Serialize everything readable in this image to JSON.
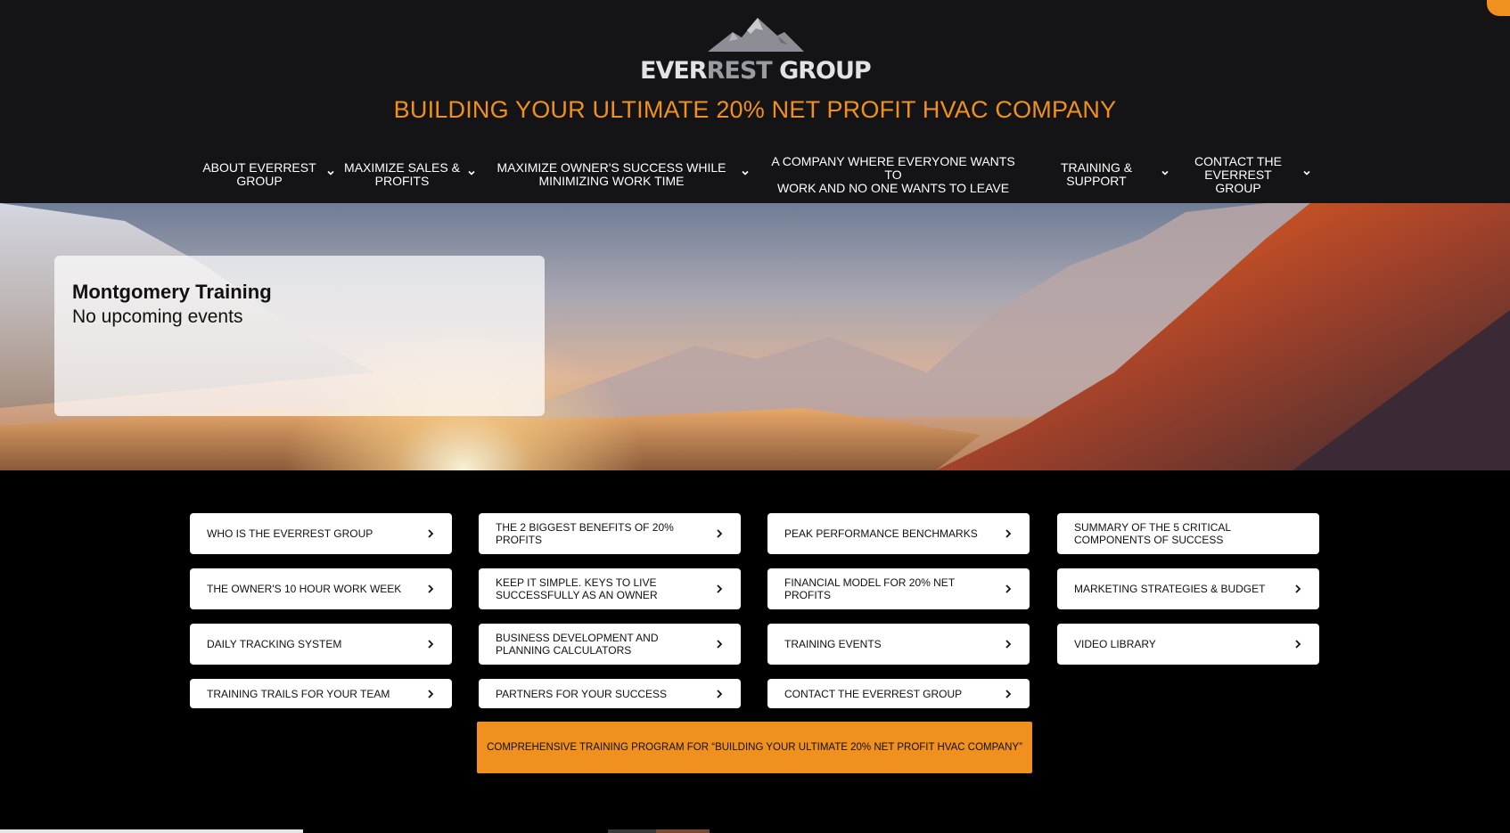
{
  "brand": {
    "logo_prefix": "EVER",
    "logo_accent": "REST",
    "logo_suffix": " GROUP",
    "logo_icon": "mountain-icon",
    "accent_color": "#f0901e",
    "header_bg": "#141416"
  },
  "tagline": "BUILDING YOUR ULTIMATE 20% NET PROFIT HVAC COMPANY",
  "nav": {
    "items": [
      {
        "label": "ABOUT EVERREST\nGROUP",
        "has_dropdown": true
      },
      {
        "label": "MAXIMIZE SALES &\nPROFITS",
        "has_dropdown": true
      },
      {
        "label": "MAXIMIZE OWNER'S SUCCESS WHILE\nMINIMIZING WORK TIME",
        "has_dropdown": true
      },
      {
        "label": "A COMPANY WHERE EVERYONE WANTS TO\nWORK AND NO ONE WANTS TO LEAVE",
        "has_dropdown": false
      },
      {
        "label": "TRAINING &\nSUPPORT",
        "has_dropdown": true
      },
      {
        "label": "CONTACT THE\nEVERREST GROUP",
        "has_dropdown": true
      }
    ]
  },
  "event_card": {
    "title": "Montgomery Training",
    "status": "No upcoming events"
  },
  "links": [
    "WHO IS THE EVERREST GROUP",
    "THE 2 BIGGEST BENEFITS OF 20% PROFITS",
    "PEAK PERFORMANCE BENCHMARKS",
    "SUMMARY OF THE 5 CRITICAL COMPONENTS OF SUCCESS",
    "THE OWNER'S 10 HOUR WORK WEEK",
    "KEEP IT SIMPLE. KEYS TO LIVE SUCCESSFULLY AS AN OWNER",
    "FINANCIAL MODEL FOR 20% NET PROFITS",
    "MARKETING STRATEGIES & BUDGET",
    "DAILY TRACKING SYSTEM",
    "BUSINESS DEVELOPMENT AND PLANNING CALCULATORS",
    "TRAINING EVENTS",
    "VIDEO LIBRARY",
    "TRAINING TRAILS FOR YOUR TEAM",
    "PARTNERS FOR YOUR SUCCESS",
    "CONTACT THE EVERREST GROUP"
  ],
  "cta": "COMPREHENSIVE TRAINING PROGRAM FOR “BUILDING YOUR ULTIMATE 20% NET PROFIT HVAC COMPANY”"
}
